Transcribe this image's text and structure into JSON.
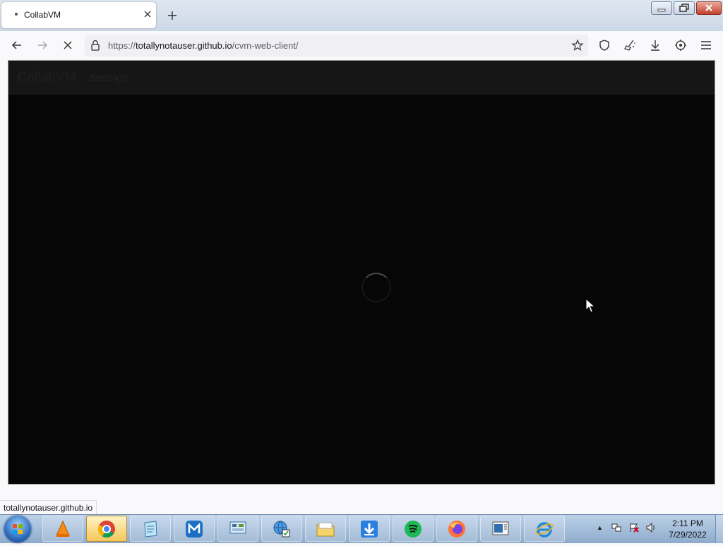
{
  "browser": {
    "tab_title": "CollabVM",
    "url_scheme": "https://",
    "url_host": "totallynotauser.github.io",
    "url_path": "/cvm-web-client/",
    "status_link": "totallynotauser.github.io"
  },
  "app": {
    "brand": "CollabVM",
    "settings_label": "Settings",
    "loading": true
  },
  "taskbar": {
    "apps": [
      "vlc-icon",
      "chrome-icon",
      "notepad-icon",
      "maxthon-icon",
      "control-panel-icon",
      "network-icon",
      "file-explorer-icon",
      "download-manager-icon",
      "spotify-icon",
      "firefox-icon",
      "remote-desktop-icon",
      "internet-explorer-icon"
    ],
    "active_app": "chrome-icon",
    "time": "2:11 PM",
    "date": "7/29/2022"
  },
  "colors": {
    "page_bg": "#060607",
    "header_bg": "#161617",
    "taskbar": "#a9c2df"
  }
}
